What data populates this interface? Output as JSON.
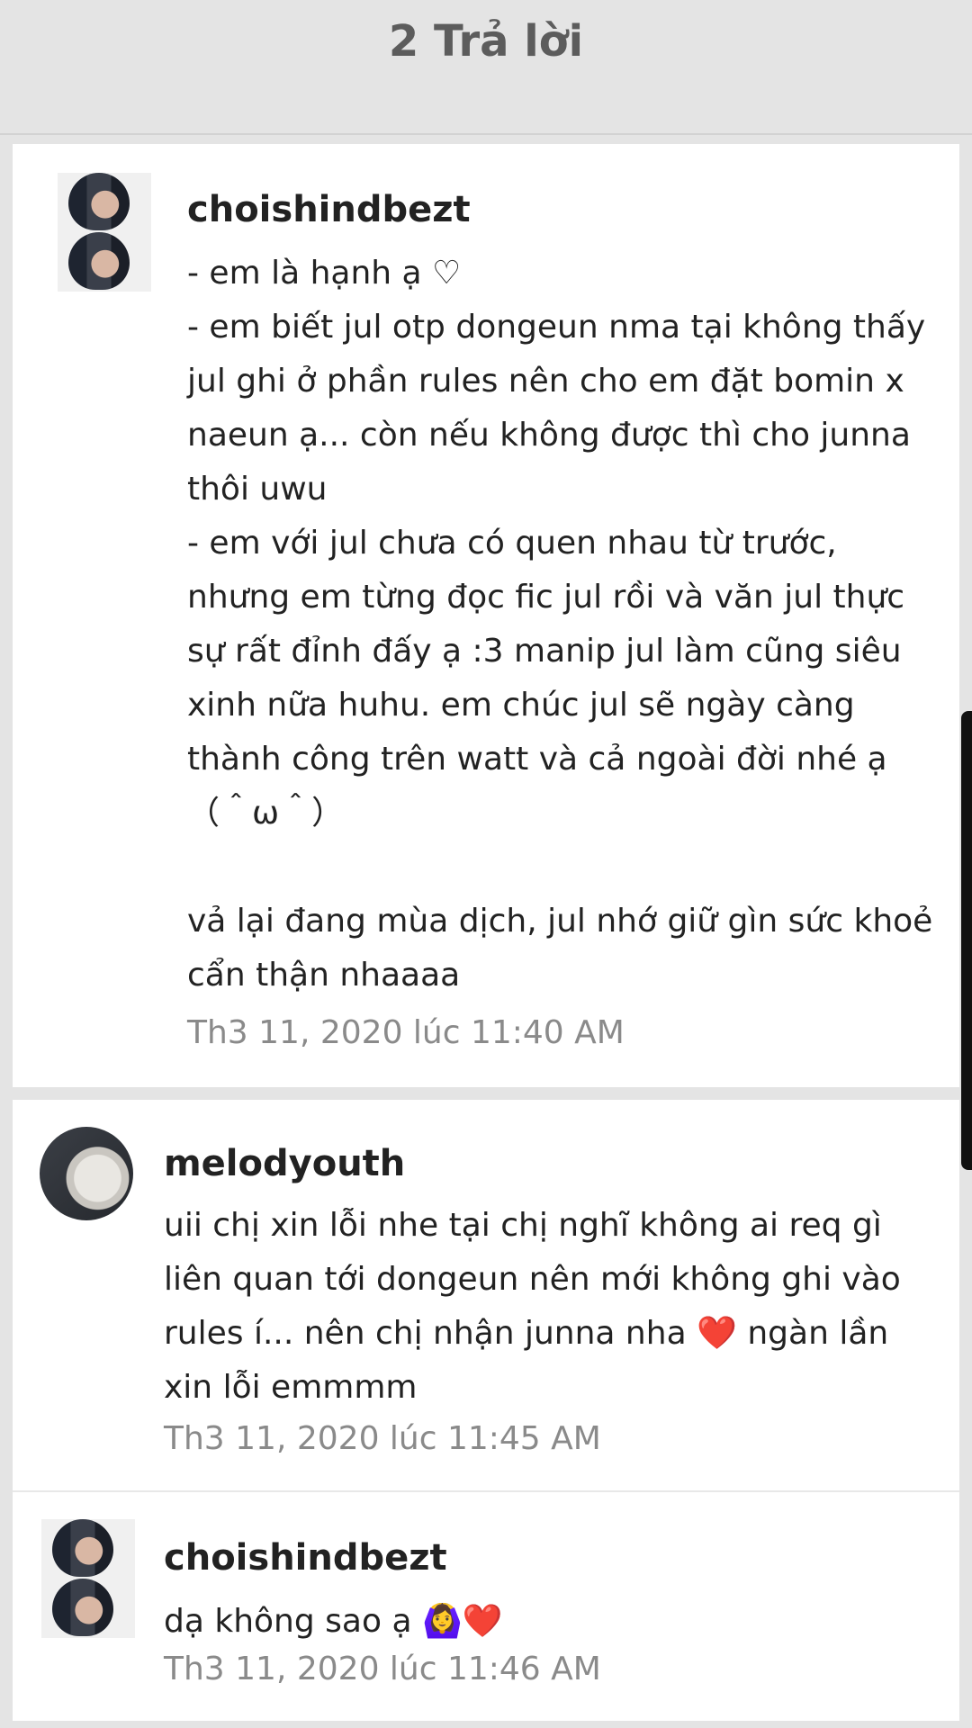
{
  "header": {
    "title": "2 Trả lời"
  },
  "comments": [
    {
      "username": "choishindbezt",
      "text": "- em là hạnh ạ ♡\n- em biết jul otp dongeun nma tại không thấy jul ghi ở phần rules nên cho em đặt bomin x naeun ạ... còn nếu không được thì cho junna thôi uwu\n- em với jul chưa có quen nhau từ trước, nhưng em từng đọc fic jul rồi và văn jul thực sự rất đỉnh đấy ạ :3 manip jul làm cũng siêu xinh nữa huhu. em chúc jul sẽ ngày càng thành công trên watt và cả ngoài đời nhé ạ\n（＾ω＾）\n\nvả lại đang mùa dịch, jul nhớ giữ gìn sức khoẻ cẩn thận nhaaaa",
      "timestamp": "Th3 11, 2020 lúc 11:40 AM"
    },
    {
      "username": "melodyouth",
      "text": "uii chị xin lỗi nhe tại chị nghĩ không ai req gì liên quan tới dongeun nên mới không ghi vào rules í... nên chị nhận junna nha ❤️ ngàn lần xin lỗi emmmm",
      "timestamp": "Th3 11, 2020 lúc 11:45 AM"
    },
    {
      "username": "choishindbezt",
      "text": "dạ không sao ạ 🙆‍♀️❤️",
      "timestamp": "Th3 11, 2020 lúc 11:46 AM"
    }
  ],
  "colors": {
    "background": "#e4e4e4",
    "card": "#ffffff",
    "header_text": "#5c5c5c",
    "body_text": "#222222",
    "timestamp_text": "#8a8a8a",
    "heart": "#e0202f"
  },
  "icons": {
    "avatar_1": "user-avatar-photo",
    "avatar_2": "user-avatar-photo",
    "avatar_3": "user-avatar-photo"
  }
}
